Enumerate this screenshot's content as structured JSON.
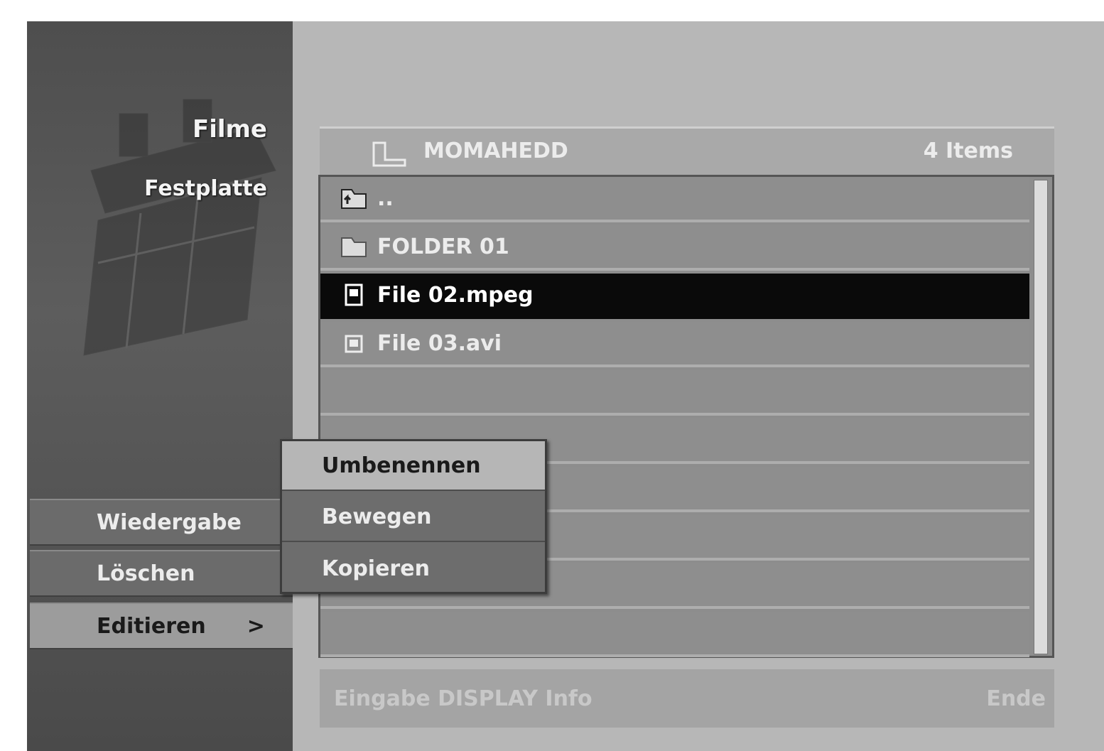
{
  "sidebar": {
    "mode_line1": "Filme",
    "mode_line2": "Festplatte",
    "menu": [
      {
        "label": "Wiedergabe"
      },
      {
        "label": "Löschen"
      },
      {
        "label": "Editieren",
        "arrow": ">"
      }
    ]
  },
  "browser": {
    "folder_name": "MOMAHEDD",
    "item_count": "4 Items",
    "rows": [
      {
        "icon": "parent-folder-icon",
        "label": ".."
      },
      {
        "icon": "folder-icon",
        "label": "FOLDER 01"
      },
      {
        "icon": "video-file-icon",
        "label": "File 02.mpeg",
        "selected": true
      },
      {
        "icon": "video-file-icon",
        "label": "File 03.avi"
      }
    ]
  },
  "submenu": {
    "items": [
      {
        "label": "Umbenennen",
        "highlight": true
      },
      {
        "label": "Bewegen"
      },
      {
        "label": "Kopieren"
      }
    ]
  },
  "footer": {
    "left": "Eingabe  DISPLAY Info",
    "right": "Ende"
  }
}
